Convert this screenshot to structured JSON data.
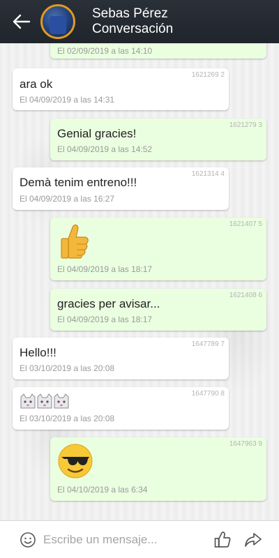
{
  "header": {
    "name": "Sebas Pérez",
    "subtitle": "Conversación"
  },
  "messages": [
    {
      "id": "",
      "direction": "out",
      "text": "",
      "time": "El 02/09/2019 a las 14:10"
    },
    {
      "id": "1621269 2",
      "direction": "in",
      "text": "ara ok",
      "time": "El 04/09/2019 a las 14:31"
    },
    {
      "id": "1621279 3",
      "direction": "out",
      "text": "Genial gracies!",
      "time": "El 04/09/2019 a las 14:52"
    },
    {
      "id": "1621314 4",
      "direction": "in",
      "text": "Demà tenim entreno!!!",
      "time": "El 04/09/2019 a las 16:27"
    },
    {
      "id": "1621407 5",
      "direction": "out",
      "text": "",
      "emoji": "thumbs-up",
      "time": "El 04/09/2019 a las 18:17"
    },
    {
      "id": "1621408 6",
      "direction": "out",
      "text": "gracies per avisar...",
      "time": "El 04/09/2019 a las 18:17"
    },
    {
      "id": "1647789 7",
      "direction": "in",
      "text": "Hello!!!",
      "time": "El 03/10/2019 a las 20:08"
    },
    {
      "id": "1647790 8",
      "direction": "in",
      "text": "",
      "emoji": "cat-faces",
      "time": "El 03/10/2019 a las 20:08"
    },
    {
      "id": "1647963 9",
      "direction": "out",
      "text": "",
      "emoji": "sunglasses-face",
      "time": "El 04/10/2019 a las 6:34"
    }
  ],
  "input": {
    "placeholder": "Escribe un mensaje..."
  },
  "colors": {
    "header_bg": "#22272e",
    "avatar_ring": "#e09a1c",
    "incoming_bubble": "#ffffff",
    "outgoing_bubble": "#eaffe0"
  }
}
